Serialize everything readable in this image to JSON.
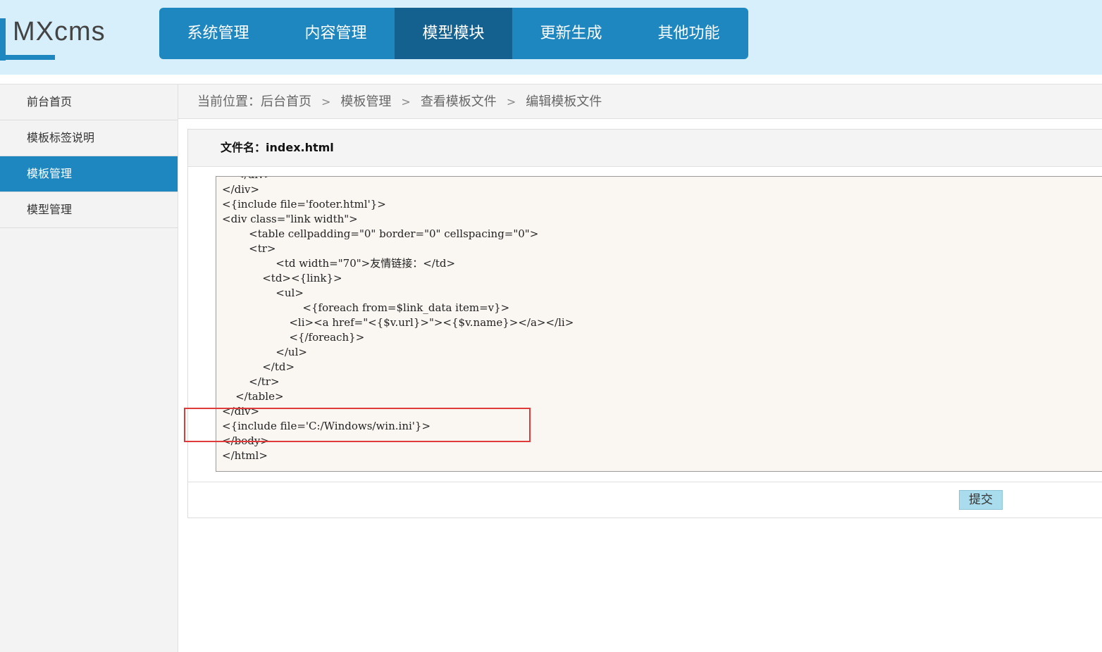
{
  "app": {
    "logo_text": "MXcms"
  },
  "topnav": {
    "items": [
      {
        "label": "系统管理"
      },
      {
        "label": "内容管理"
      },
      {
        "label": "模型模块"
      },
      {
        "label": "更新生成"
      },
      {
        "label": "其他功能"
      }
    ],
    "active_index": 2
  },
  "sidebar": {
    "items": [
      {
        "label": "前台首页"
      },
      {
        "label": "模板标签说明"
      },
      {
        "label": "模板管理"
      },
      {
        "label": "模型管理"
      }
    ],
    "active_index": 2
  },
  "breadcrumb": {
    "prefix": "当前位置：",
    "items": [
      "后台首页",
      "模板管理",
      "查看模板文件",
      "编辑模板文件"
    ],
    "separator": ">"
  },
  "file": {
    "label": "文件名：",
    "name": "index.html"
  },
  "editor": {
    "code": "    </div>\n</div>\n<{include file='footer.html'}>\n<div class=\"link width\">\n        <table cellpadding=\"0\" border=\"0\" cellspacing=\"0\">\n        <tr>\n                <td width=\"70\">友情链接：</td>\n            <td><{link}>\n                <ul>\n                        <{foreach from=$link_data item=v}>\n                    <li><a href=\"<{$v.url}>\"><{$v.name}></a></li>\n                    <{/foreach}>\n                </ul>\n            </td>\n        </tr>\n    </table>\n</div>\n<{include file='C:/Windows/win.ini'}>\n</body>\n</html>"
  },
  "actions": {
    "submit_label": "提交"
  },
  "colors": {
    "accent": "#1f87c0",
    "accent_dark": "#14618f",
    "header_bg": "#d7effb",
    "highlight": "#e03b3b"
  }
}
